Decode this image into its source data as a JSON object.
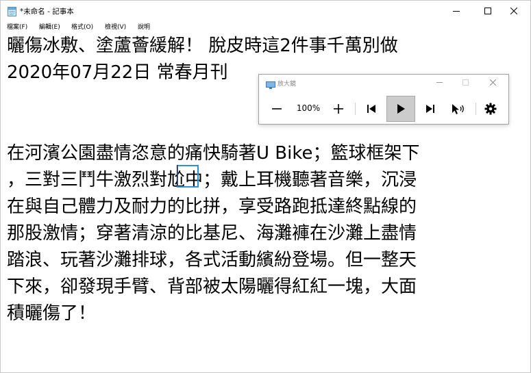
{
  "window": {
    "title": "*未命名 - 記事本"
  },
  "menu": [
    {
      "label": "檔案(F)"
    },
    {
      "label": "編輯(E)"
    },
    {
      "label": "格式(O)"
    },
    {
      "label": "檢視(V)"
    },
    {
      "label": "說明"
    }
  ],
  "editor": {
    "lines": [
      "曬傷冰敷、塗蘆薈緩解！ 脫皮時這2件事千萬別做",
      "2020年07月22日 常春月刊",
      "在河濱公園盡情恣意的痛快騎著U Bike；籃球框架下",
      "，三對三鬥牛激烈對尬中；戴上耳機聽著音樂，沉浸",
      "在與自己體力及耐力的比拼，享受路跑抵達終點線的",
      "那股激情；穿著清涼的比基尼、海灘褲在沙灘上盡情",
      "踏浪、玩著沙灘排球，各式活動繽紛登場。但一整天",
      "下來，卻發現手臂、背部被太陽曬得紅紅一塊，大面",
      "積曬傷了！"
    ]
  },
  "magnifier": {
    "title": "放大鏡",
    "zoom_label": "100%"
  },
  "icons": {
    "app": "notepad-icon",
    "minimize": "minimize-icon",
    "maximize": "maximize-icon",
    "close": "close-icon"
  },
  "colors": {
    "lens_frame": "#2a8fd6",
    "play_button_bg": "#cccccc"
  }
}
